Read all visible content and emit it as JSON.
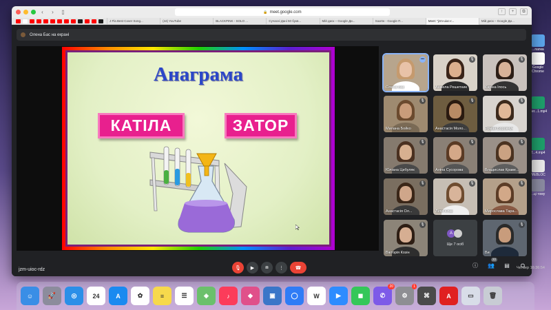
{
  "browser": {
    "url": "meet.google.com",
    "tabs": [
      "J Fla Best Cover Song...",
      "(44) YouTube",
      "BLACKPINK - SOLO ...",
      "Сучасні Дані 50 букв...",
      "Мій диск – Google Ди...",
      "Хазяїн - Google П...",
      "Meet: \"jzm-uioc-r...",
      "Мій диск – Google Ди..."
    ],
    "active_tab_index": 6,
    "bookmark_icon_colors": [
      "#ff0000",
      "#ffffff",
      "#ff0000",
      "#ff0000",
      "#ff0000",
      "#ff0000",
      "#ff0000",
      "#ff0000",
      "#ff0000",
      "#1a1a1a",
      "#ff0000",
      "#ff0000",
      "#1a1a1a"
    ]
  },
  "meet": {
    "presenting_banner": "Олена Бас на екрані",
    "meeting_code": "jzm-uioc-rdz",
    "participants_count": "22",
    "slide": {
      "title": "Анаграма",
      "words": [
        "КАТІЛА",
        "ЗАТОР"
      ]
    },
    "participants": [
      {
        "name": "Олена Бас",
        "skin": "#e8c2a8",
        "hair": "#c59a6e",
        "body": "#ffffff",
        "bg": "#b7a58d",
        "highlight": true
      },
      {
        "name": "Анжела Решетник",
        "skin": "#dcb08e",
        "hair": "#3a2418",
        "body": "#2b2b2b",
        "bg": "#d9d2c8",
        "highlight": false
      },
      {
        "name": "Каріна Іпось",
        "skin": "#d8b298",
        "hair": "#2c1e16",
        "body": "#333333",
        "bg": "#c9c2bd",
        "highlight": false
      },
      {
        "name": "Милана Бойко",
        "skin": "#c99c7a",
        "hair": "#6b4a2e",
        "body": "#7a6a55",
        "bg": "#9e8a70",
        "highlight": false
      },
      {
        "name": "Анастасія Моло...",
        "skin": "#b88a64",
        "hair": "#2a1a10",
        "body": "#3d3d3d",
        "bg": "#6e5d40",
        "highlight": false
      },
      {
        "name": "Роман Боровчук",
        "skin": "#e0b898",
        "hair": "#3c2a1c",
        "body": "#e8e8e8",
        "bg": "#d8d4cf",
        "highlight": false
      },
      {
        "name": "Юліана Цибуляк",
        "skin": "#d7b090",
        "hair": "#4a3020",
        "body": "#4a4a4a",
        "bg": "#857a6e",
        "highlight": false
      },
      {
        "name": "Аліна Сусорова",
        "skin": "#d4a888",
        "hair": "#5a3a24",
        "body": "#555555",
        "bg": "#8a8076",
        "highlight": false
      },
      {
        "name": "Владислав Краве...",
        "skin": "#caa282",
        "hair": "#4a3220",
        "body": "#5e5e5e",
        "bg": "#9a9088",
        "highlight": false
      },
      {
        "name": "Анастасія Ол... ",
        "skin": "#cfa68a",
        "hair": "#3a2618",
        "body": "#3a3a3a",
        "bg": "#7a6e60",
        "highlight": false
      },
      {
        "name": "Лілія Клак",
        "skin": "#d8b49a",
        "hair": "#6e4c30",
        "body": "#f0f0f0",
        "bg": "#c6beb4",
        "highlight": false
      },
      {
        "name": "Мирослава Тара...",
        "skin": "#d2a888",
        "hair": "#5c3c26",
        "body": "#8a5a44",
        "bg": "#b4a08a",
        "highlight": false
      },
      {
        "name": "Вікторія Козін",
        "skin": "#d6ae92",
        "hair": "#2e1e14",
        "body": "#2e2e2e",
        "bg": "#8c8478",
        "highlight": false
      },
      {
        "name": "Ви",
        "skin": "#c89c7c",
        "hair": "#2a2a2a",
        "body": "#1e2a3a",
        "bg": "#5e6670",
        "highlight": false
      }
    ],
    "more_tile": {
      "label": "Ще 7 осіб",
      "avatar_letter": "А"
    },
    "clock": "Четвер 16:36:54"
  },
  "desktop_icons": [
    {
      "label": "...папка",
      "color": "#5ba4ea"
    },
    {
      "label": "Google Chrome",
      "color": "#ffffff"
    },
    {
      "label": "...er...1.mp4",
      "color": "#1e9e6a"
    },
    {
      "label": "2...4.mp4",
      "color": "#1e9e6a"
    },
    {
      "label": "WEBLOC",
      "color": "#e8e8e8"
    },
    {
      "label": "...ці тому",
      "color": "#8a8aa0"
    }
  ],
  "dock_apps": [
    {
      "name": "Finder",
      "color": "#3a8ee6",
      "label": "☺",
      "badge": ""
    },
    {
      "name": "Launchpad",
      "color": "#8c8c9c",
      "label": "🚀",
      "badge": ""
    },
    {
      "name": "Safari",
      "color": "#2b8fe8",
      "label": "◎",
      "badge": ""
    },
    {
      "name": "Calendar",
      "color": "#ffffff",
      "label": "24",
      "badge": ""
    },
    {
      "name": "App Store",
      "color": "#1a8af0",
      "label": "A",
      "badge": ""
    },
    {
      "name": "Photos",
      "color": "#ffffff",
      "label": "✿",
      "badge": ""
    },
    {
      "name": "Notes",
      "color": "#f7d94c",
      "label": "≡",
      "badge": ""
    },
    {
      "name": "Reminders",
      "color": "#ffffff",
      "label": "☰",
      "badge": ""
    },
    {
      "name": "Maps",
      "color": "#6bc06b",
      "label": "◈",
      "badge": ""
    },
    {
      "name": "Music",
      "color": "#fc3c5a",
      "label": "♪",
      "badge": ""
    },
    {
      "name": "CleanMyMac",
      "color": "#e0508a",
      "label": "◆",
      "badge": ""
    },
    {
      "name": "Preview",
      "color": "#3a76c8",
      "label": "▣",
      "badge": ""
    },
    {
      "name": "Messenger",
      "color": "#2f7cf6",
      "label": "◯",
      "badge": ""
    },
    {
      "name": "WPS Office",
      "color": "#ffffff",
      "label": "W",
      "badge": ""
    },
    {
      "name": "Zoom",
      "color": "#2d8cff",
      "label": "▶",
      "badge": ""
    },
    {
      "name": "FaceTime",
      "color": "#34c759",
      "label": "◼",
      "badge": ""
    },
    {
      "name": "Viber",
      "color": "#7d5ae8",
      "label": "✆",
      "badge": "20"
    },
    {
      "name": "System Preferences",
      "color": "#8e8e93",
      "label": "⚙",
      "badge": "1"
    },
    {
      "name": "Screenshot",
      "color": "#4a4a4a",
      "label": "⌘",
      "badge": ""
    },
    {
      "name": "Adobe Acrobat",
      "color": "#e02020",
      "label": "A",
      "badge": ""
    },
    {
      "name": "Downloads",
      "color": "#d8dde8",
      "label": "▭",
      "badge": ""
    },
    {
      "name": "Trash",
      "color": "#c8ccd4",
      "label": "🗑",
      "badge": ""
    }
  ]
}
